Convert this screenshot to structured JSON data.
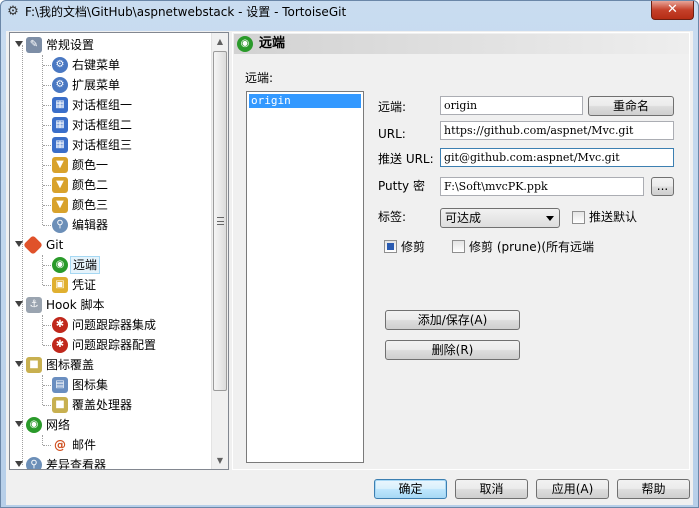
{
  "window": {
    "title": "F:\\我的文档\\GitHub\\aspnetwebstack - 设置 - TortoiseGit",
    "close_label": "✕"
  },
  "tree": {
    "items": [
      {
        "label": "常规设置",
        "icon": "wrench-icon"
      },
      {
        "label": "右键菜单",
        "icon": "gear-icon"
      },
      {
        "label": "扩展菜单",
        "icon": "gear-icon"
      },
      {
        "label": "对话框组一",
        "icon": "windows-icon"
      },
      {
        "label": "对话框组二",
        "icon": "windows-icon"
      },
      {
        "label": "对话框组三",
        "icon": "windows-icon"
      },
      {
        "label": "颜色一",
        "icon": "palette-icon"
      },
      {
        "label": "颜色二",
        "icon": "palette-icon"
      },
      {
        "label": "颜色三",
        "icon": "palette-icon"
      },
      {
        "label": "编辑器",
        "icon": "magnifier-icon"
      },
      {
        "label": "Git",
        "icon": "git-icon"
      },
      {
        "label": "远端",
        "icon": "globe-icon"
      },
      {
        "label": "凭证",
        "icon": "lock-icon"
      },
      {
        "label": "Hook 脚本",
        "icon": "hook-icon"
      },
      {
        "label": "问题跟踪器集成",
        "icon": "bug-icon"
      },
      {
        "label": "问题跟踪器配置",
        "icon": "bug-icon"
      },
      {
        "label": "图标覆盖",
        "icon": "overlay-icon"
      },
      {
        "label": "图标集",
        "icon": "iconset-icon"
      },
      {
        "label": "覆盖处理器",
        "icon": "overlay-icon"
      },
      {
        "label": "网络",
        "icon": "globe-icon"
      },
      {
        "label": "邮件",
        "icon": "email-icon"
      },
      {
        "label": "差异查看器",
        "icon": "magnifier-icon"
      }
    ]
  },
  "panel": {
    "title": "远端",
    "remotes_label": "远端:",
    "remotes": [
      "origin"
    ],
    "remote_label": "远端:",
    "remote_value": "origin",
    "rename_button": "重命名",
    "url_label": "URL:",
    "url_value": "https://github.com/aspnet/Mvc.git",
    "push_url_label": "推送 URL:",
    "push_url_value": "git@github.com:aspnet/Mvc.git",
    "putty_label": "Putty 密",
    "putty_value": "F:\\Soft\\mvcPK.ppk",
    "browse_button": "...",
    "tags_label": "标签:",
    "tags_value": "可达成",
    "push_default_label": "推送默认",
    "prune_label": "修剪",
    "prune_all_label": "修剪 (prune)(所有远端",
    "add_save_button": "添加/保存(A)",
    "delete_button": "删除(R)"
  },
  "buttons": {
    "ok": "确定",
    "cancel": "取消",
    "apply": "应用(A)",
    "help": "帮助"
  },
  "colors": {
    "selection": "#3399ff",
    "titlebar": "#c9dcf0",
    "close": "#c5402a"
  }
}
